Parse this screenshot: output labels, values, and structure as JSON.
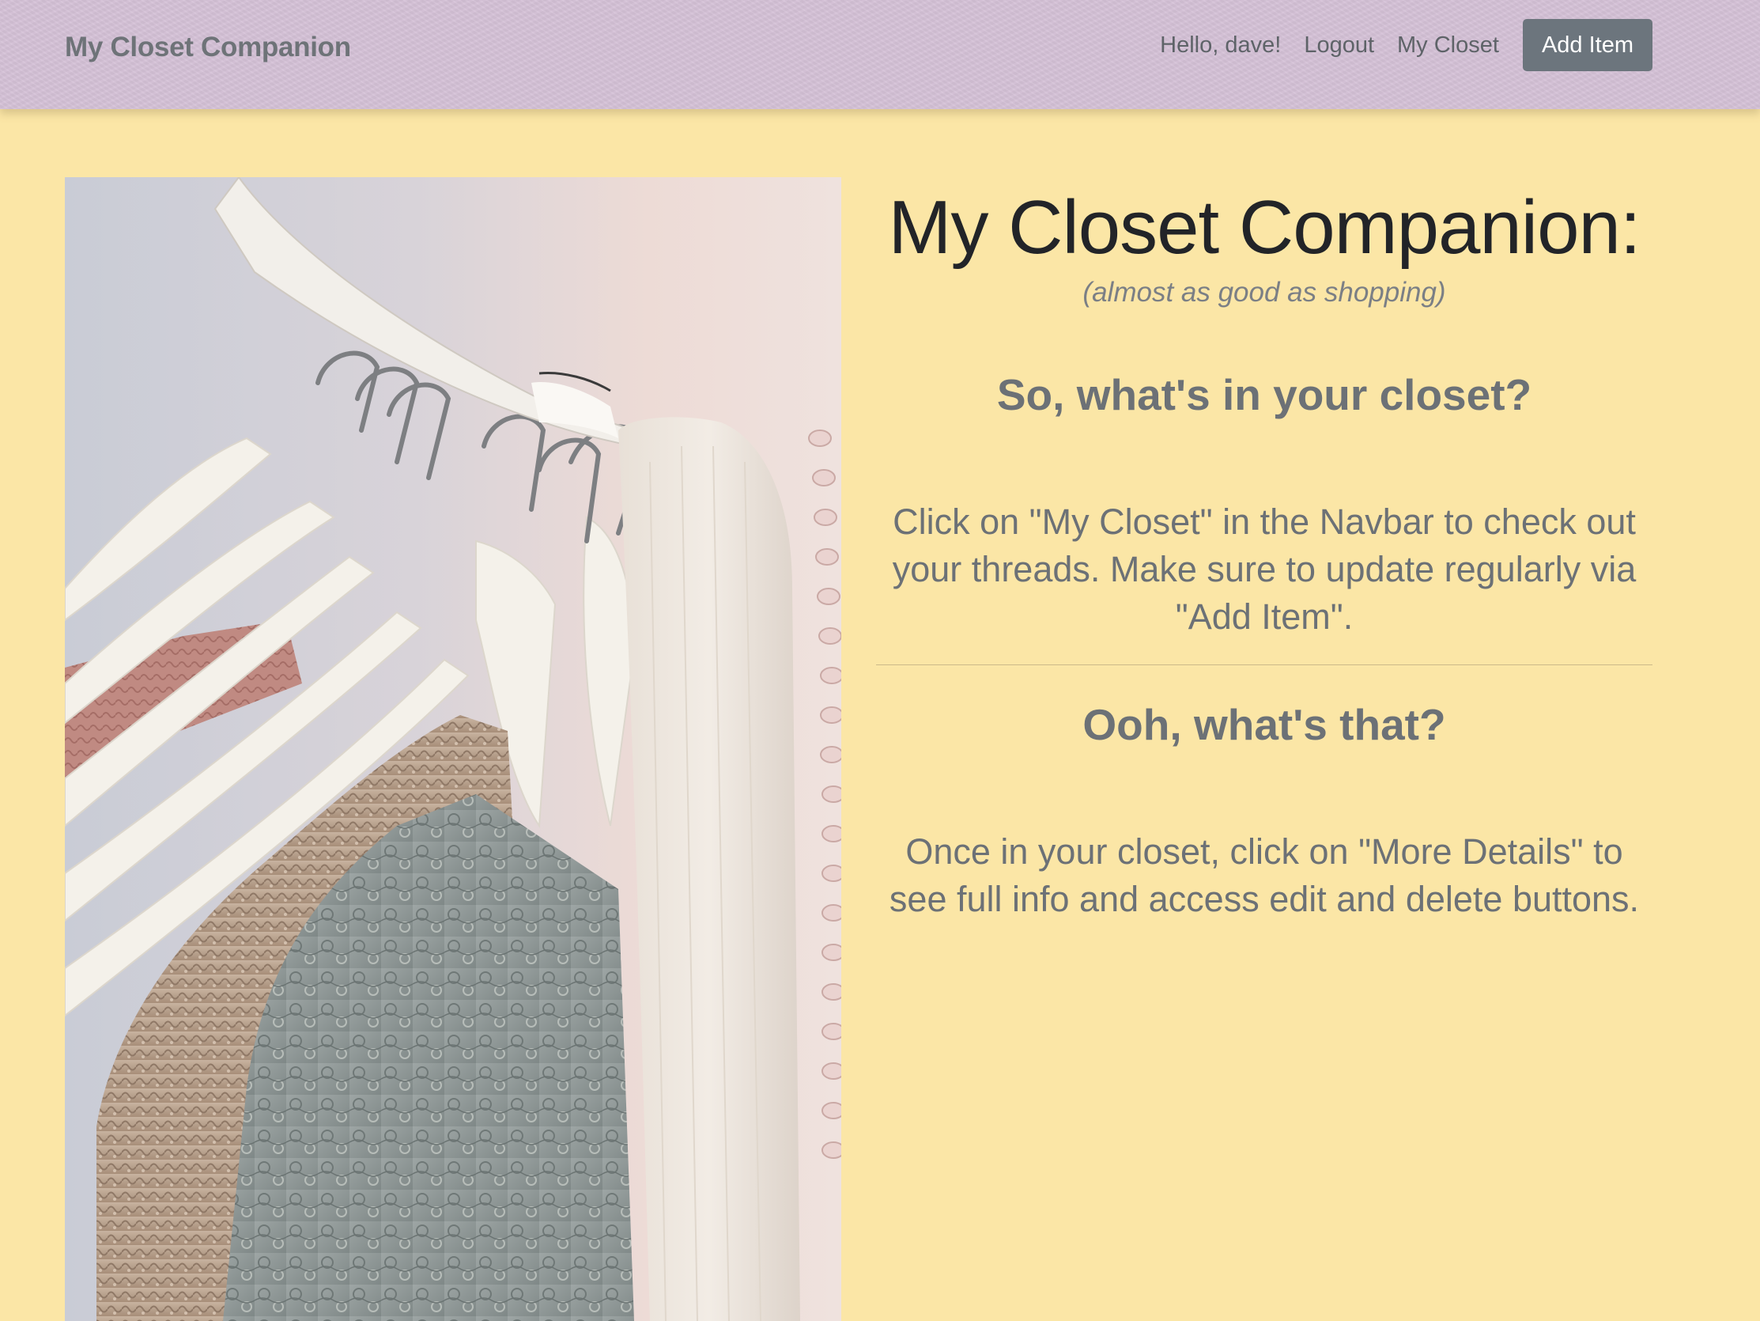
{
  "navbar": {
    "brand": "My Closet Companion",
    "greeting": "Hello, dave!",
    "logout_label": "Logout",
    "my_closet_label": "My Closet",
    "add_item_label": "Add Item"
  },
  "hero": {
    "image_alt": "clothes-on-rack-photo"
  },
  "content": {
    "title": "My Closet Companion:",
    "subtitle": "(almost as good as shopping)",
    "section1_heading": "So, what's in your closet?",
    "section1_text": "Click on \"My Closet\" in the Navbar to check out your threads. Make sure to update regularly via \"Add Item\".",
    "section2_heading": "Ooh, what's that?",
    "section2_text": "Once in your closet, click on \"More Details\" to see full info and access edit and delete buttons."
  },
  "colors": {
    "page_background": "#fbe6a6",
    "navbar_background": "#d4c1d6",
    "button_background": "#6c757d",
    "text_muted": "#6c7176",
    "title_text": "#222428"
  }
}
